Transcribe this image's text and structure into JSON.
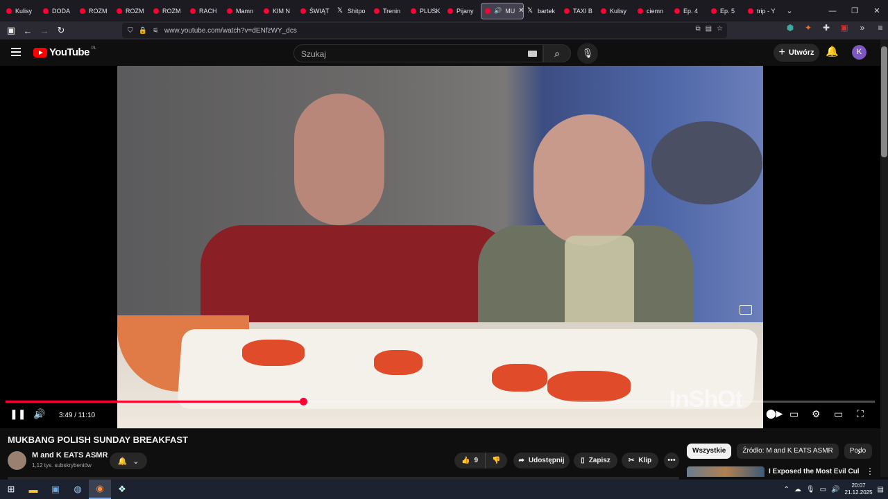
{
  "browser": {
    "tabs": [
      {
        "label": "Kulisy",
        "icon": "youtube-icon"
      },
      {
        "label": "DODA",
        "icon": "youtube-icon"
      },
      {
        "label": "ROZM",
        "icon": "youtube-icon"
      },
      {
        "label": "ROZM",
        "icon": "youtube-icon"
      },
      {
        "label": "ROZM",
        "icon": "youtube-icon"
      },
      {
        "label": "RACH",
        "icon": "youtube-icon"
      },
      {
        "label": "Mamn",
        "icon": "youtube-icon"
      },
      {
        "label": "KIM N",
        "icon": "youtube-icon"
      },
      {
        "label": "ŚWIĄT",
        "icon": "youtube-icon"
      },
      {
        "label": "Shitpo",
        "icon": "x-icon"
      },
      {
        "label": "Trenin",
        "icon": "youtube-icon"
      },
      {
        "label": "PLUSK",
        "icon": "youtube-icon"
      },
      {
        "label": "Pijany",
        "icon": "youtube-icon"
      },
      {
        "label": "MU",
        "icon": "youtube-icon",
        "active": true
      },
      {
        "label": "bartek",
        "icon": "x-icon"
      },
      {
        "label": "TAXI B",
        "icon": "youtube-icon"
      },
      {
        "label": "Kulisy",
        "icon": "youtube-icon"
      },
      {
        "label": "ciemn",
        "icon": "youtube-icon"
      },
      {
        "label": "Ep. 4",
        "icon": "youtube-icon"
      },
      {
        "label": "Ep. 5",
        "icon": "youtube-icon"
      },
      {
        "label": "trip - Y",
        "icon": "youtube-icon"
      }
    ],
    "url": "www.youtube.com/watch?v=dENfzWY_dcs"
  },
  "youtube": {
    "logo_text": "YouTube",
    "logo_region": "PL",
    "search_placeholder": "Szukaj",
    "create_label": "Utwórz",
    "avatar_initial": "K"
  },
  "player": {
    "current_time": "3:49",
    "duration": "11:10",
    "time_display": "3:49 / 11:10",
    "progress_fraction": 0.343,
    "watermark": "InShOt"
  },
  "video": {
    "title": "MUKBANG POLISH SUNDAY BREAKFAST",
    "channel": "M and K EATS ASMR",
    "subscribers": "1,12 tys. subskrybentów",
    "likes": "9",
    "share_label": "Udostępnij",
    "save_label": "Zapisz",
    "clip_label": "Klip"
  },
  "sidebar": {
    "chips": [
      "Wszystkie",
      "Źródło: M and K EATS ASMR",
      "Podo"
    ],
    "recommendation_title": "I Exposed the Most Evil Cult in America"
  },
  "taskbar": {
    "time": "20:07",
    "date": "21.12.2025"
  },
  "colors": {
    "accent_red": "#ff0033",
    "background": "#0f0f0f",
    "chip_bg": "#272727"
  }
}
